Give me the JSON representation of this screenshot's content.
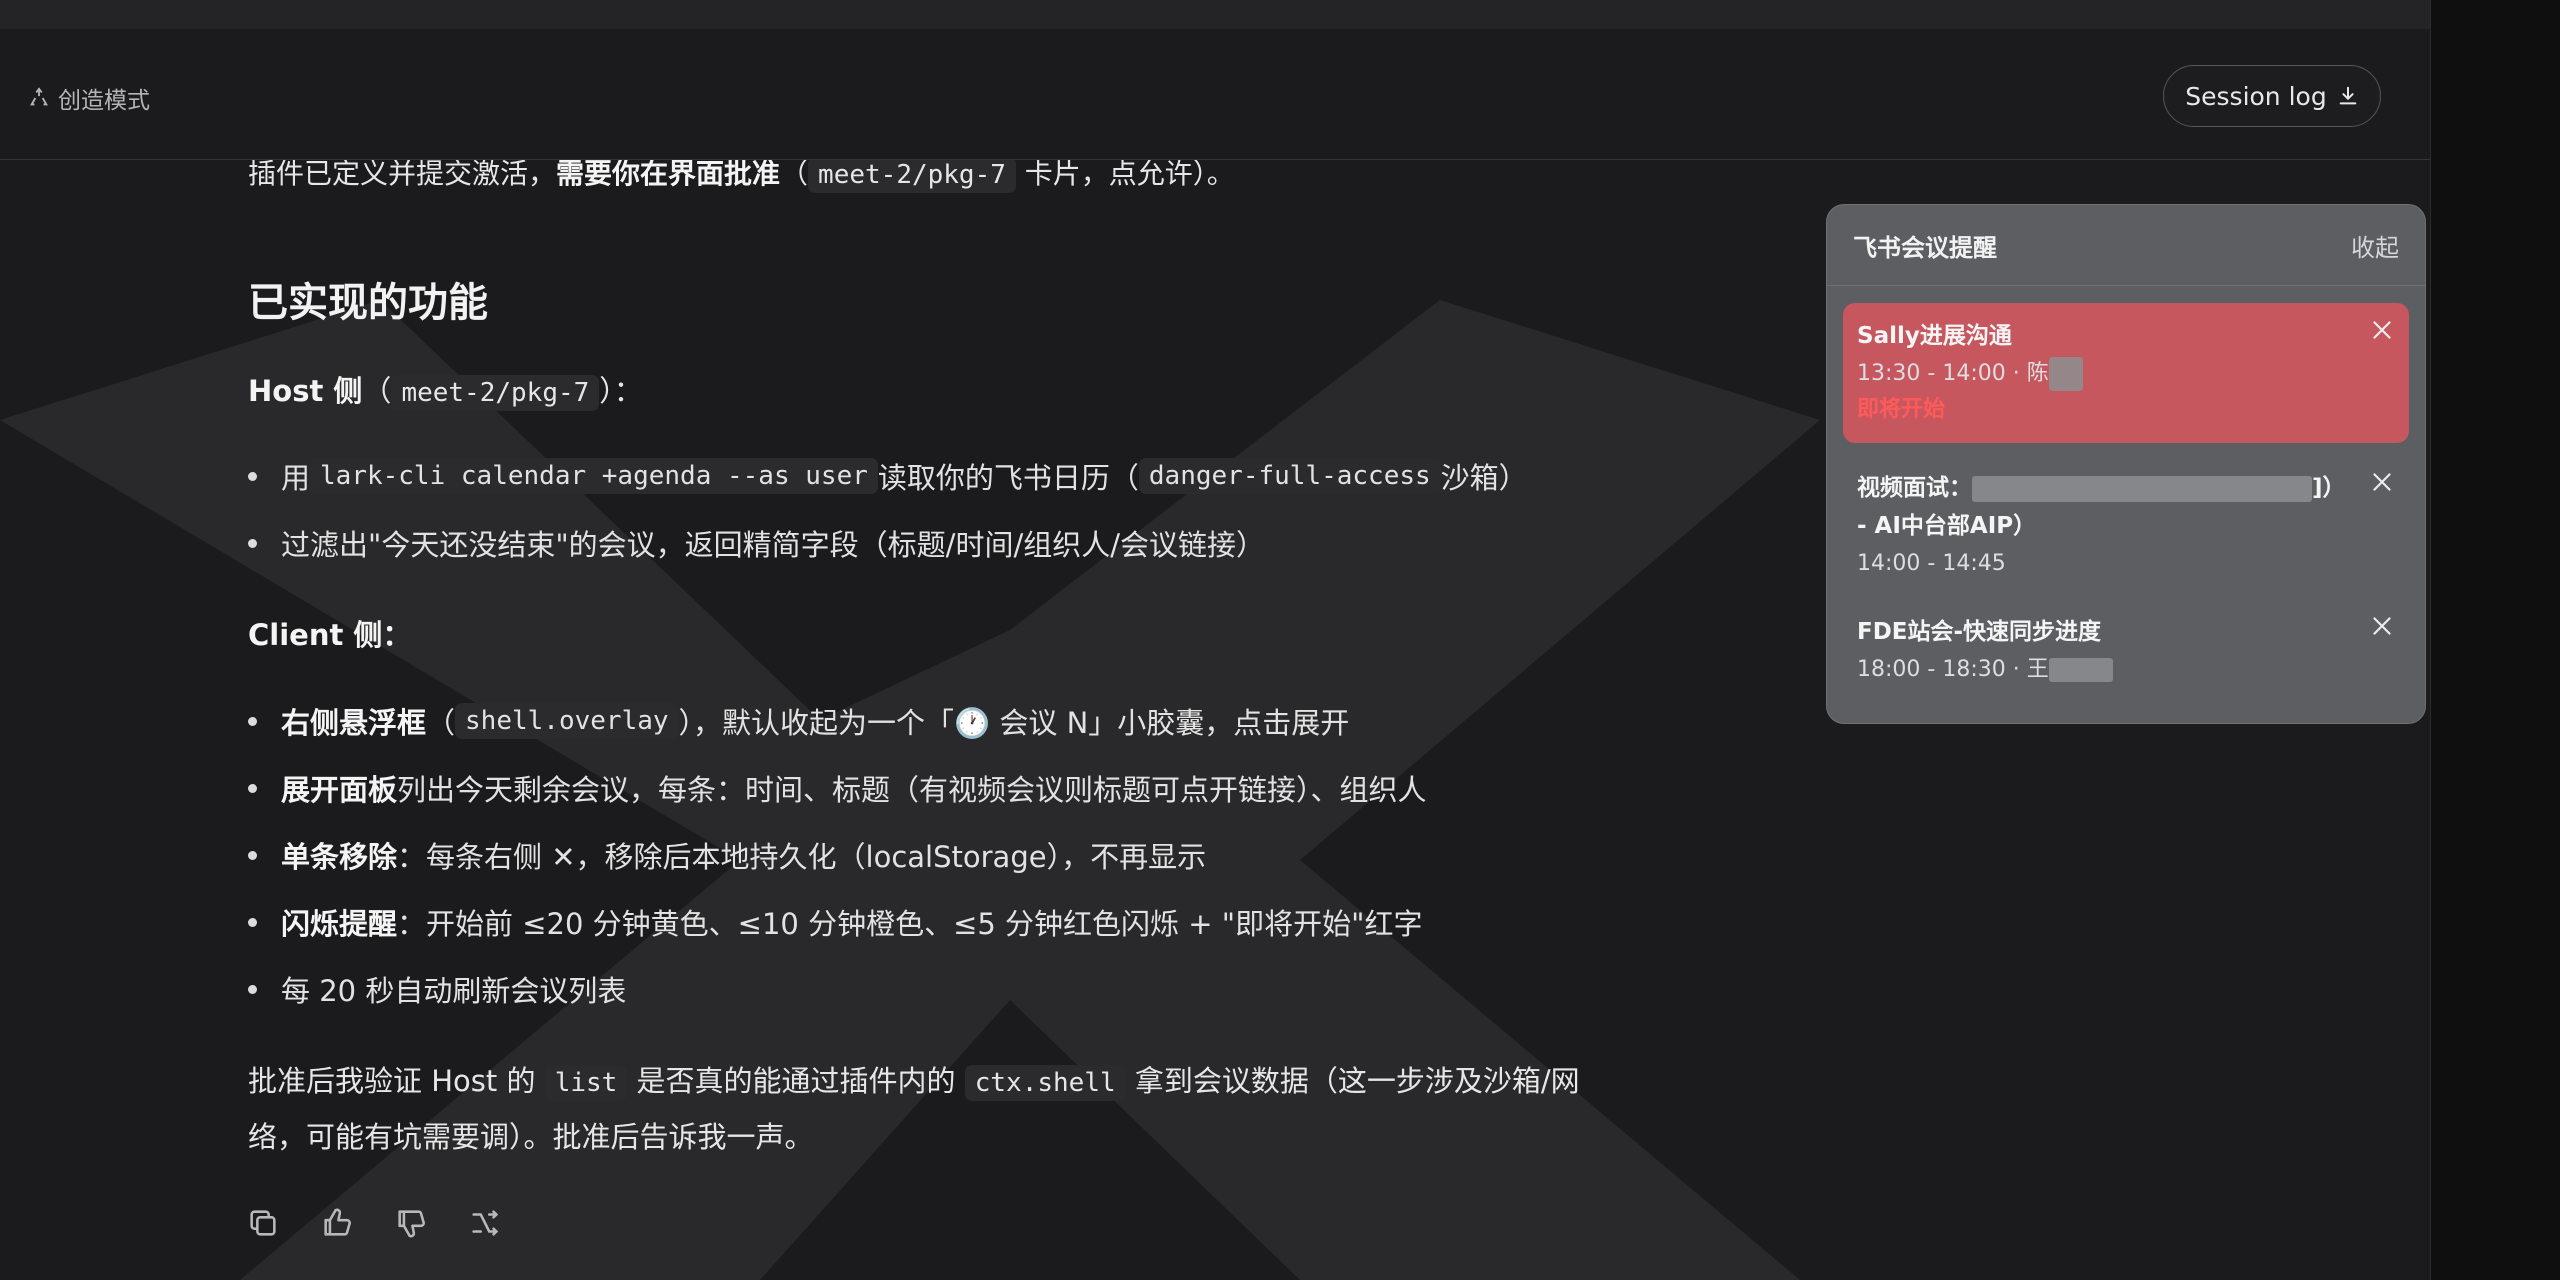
{
  "header": {
    "mode_label": "创造模式",
    "session_log_label": "Session log"
  },
  "content": {
    "cut_line_prefix": "插件已定义并提交激活，",
    "cut_line_bold": "需要你在界面批准",
    "cut_line_mid": "（",
    "cut_line_code": "meet-2/pkg-7",
    "cut_line_suffix": " 卡片，点允许）。",
    "section_title": "已实现的功能",
    "host_label": "Host 侧",
    "host_paren_open": "（",
    "host_code": "meet-2/pkg-7",
    "host_paren_close": "）：",
    "host_items": [
      {
        "pre": "用 ",
        "code1": "lark-cli calendar +agenda --as user",
        "mid": " 读取你的飞书日历（",
        "code2": "danger-full-access",
        "post": " 沙箱）"
      },
      {
        "text": "过滤出\"今天还没结束\"的会议，返回精简字段（标题/时间/组织人/会议链接）"
      }
    ],
    "client_label": "Client 侧：",
    "client_items": [
      {
        "bold": "右侧悬浮框",
        "paren": "（",
        "code": "shell.overlay",
        "rest": "），默认收起为一个「🕐 会议 N」小胶囊，点击展开"
      },
      {
        "bold": "展开面板",
        "rest": "列出今天剩余会议，每条：时间、标题（有视频会议则标题可点开链接）、组织人"
      },
      {
        "bold": "单条移除",
        "rest": "：每条右侧 ✕，移除后本地持久化（localStorage），不再显示"
      },
      {
        "bold": "闪烁提醒",
        "rest": "：开始前 ≤20 分钟黄色、≤10 分钟橙色、≤5 分钟红色闪烁 + \"即将开始\"红字"
      },
      {
        "text": "每 20 秒自动刷新会议列表"
      }
    ],
    "closing_pre": "批准后我验证 Host 的 ",
    "closing_code1": "list",
    "closing_mid": " 是否真的能通过插件内的 ",
    "closing_code2": "ctx.shell",
    "closing_post": " 拿到会议数据（这一步涉及沙箱/网",
    "closing_line2": "络，可能有坑需要调）。批准后告诉我一声。"
  },
  "actions": [
    "copy-icon",
    "thumbs-up-icon",
    "thumbs-down-icon",
    "branch-icon"
  ],
  "panel": {
    "title": "飞书会议提醒",
    "collapse_label": "收起",
    "meetings": [
      {
        "title": "Sally进展沟通",
        "time": "13:30 - 14:00 · 陈",
        "status": "即将开始",
        "color": "#c7575e"
      },
      {
        "title_a": "视频面试：",
        "title_b": "]）",
        "title_line2": "- AI中台部AIP）",
        "time": "14:00 - 14:45"
      },
      {
        "title": "FDE站会-快速同步进度",
        "time": "18:00 - 18:30 · 王"
      }
    ]
  }
}
